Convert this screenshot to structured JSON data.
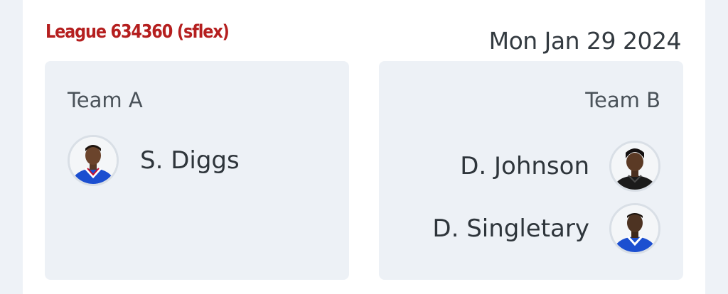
{
  "header": {
    "league_title": "League 634360 (sflex)",
    "date": "Mon Jan 29 2024",
    "title_color": "#b51f1f"
  },
  "team_a": {
    "name": "Team A",
    "players": [
      {
        "name": "S. Diggs",
        "avatar": "player-photo-diggs"
      }
    ]
  },
  "team_b": {
    "name": "Team B",
    "players": [
      {
        "name": "D. Johnson",
        "avatar": "player-photo-johnson"
      },
      {
        "name": "D. Singletary",
        "avatar": "player-photo-singletary"
      }
    ]
  }
}
